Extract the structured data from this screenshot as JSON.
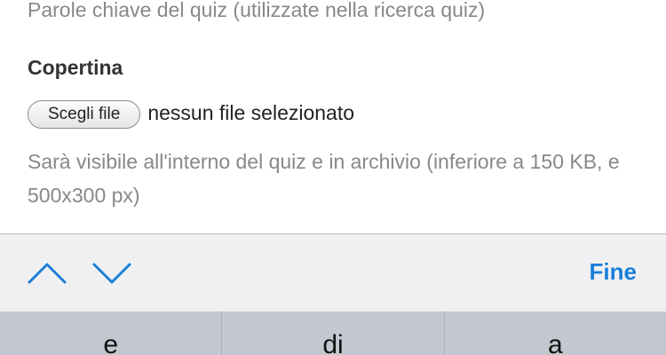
{
  "form": {
    "keywords_hint": "Parole chiave del quiz (utilizzate nella ricerca quiz)",
    "cover_title": "Copertina",
    "choose_file_label": "Scegli file",
    "file_status": "nessun file selezionato",
    "cover_help": "Sarà visibile all'interno del quiz e in archivio (inferiore a 150 KB, e 500x300 px)"
  },
  "accessory": {
    "up_icon": "chevron-up-icon",
    "down_icon": "chevron-down-icon",
    "done_label": "Fine",
    "accent_color": "#1a7fd8"
  },
  "keyboard": {
    "suggestions": [
      "e",
      "di",
      "a"
    ]
  }
}
